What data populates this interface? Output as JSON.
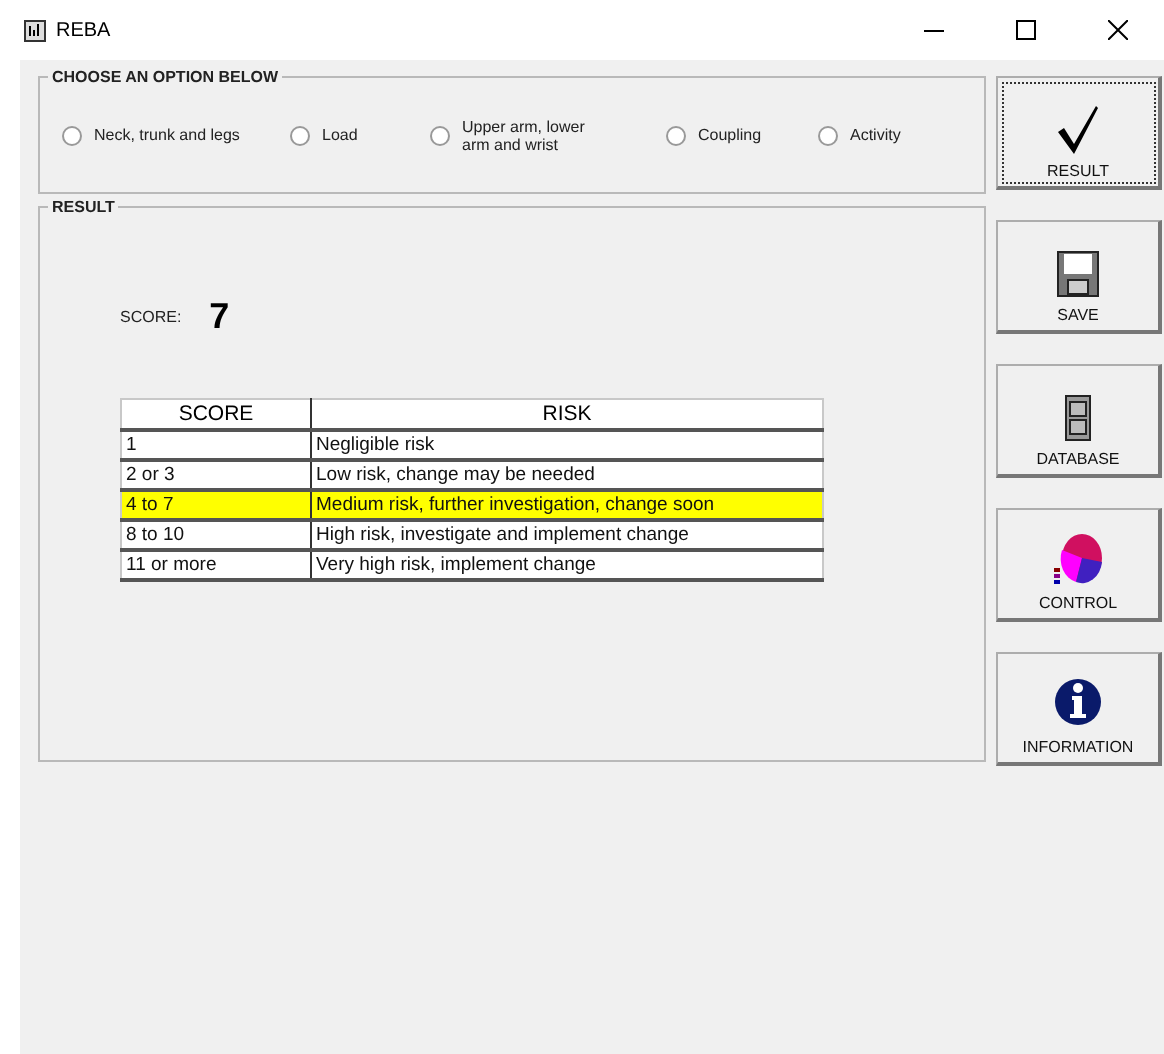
{
  "window": {
    "title": "REBA"
  },
  "options": {
    "title": "CHOOSE AN OPTION BELOW",
    "items": [
      {
        "label": "Neck, trunk and legs",
        "selected": false
      },
      {
        "label": "Load",
        "selected": false
      },
      {
        "label": "Upper arm, lower arm and wrist",
        "selected": false
      },
      {
        "label": "Coupling",
        "selected": false
      },
      {
        "label": "Activity",
        "selected": false
      }
    ]
  },
  "result": {
    "title": "RESULT",
    "score_label": "SCORE:",
    "score": "7",
    "table": {
      "columns": [
        "SCORE",
        "RISK"
      ],
      "rows": [
        {
          "cells": [
            "1",
            "Negligible risk"
          ],
          "highlighted": false
        },
        {
          "cells": [
            "2 or 3",
            "Low risk, change may be needed"
          ],
          "highlighted": false
        },
        {
          "cells": [
            "4 to 7",
            "Medium risk, further investigation, change soon"
          ],
          "highlighted": true
        },
        {
          "cells": [
            "8 to 10",
            "High risk, investigate and implement change"
          ],
          "highlighted": false
        },
        {
          "cells": [
            "11 or more",
            "Very high risk, implement change"
          ],
          "highlighted": false
        }
      ]
    }
  },
  "buttons": [
    {
      "label": "RESULT",
      "kind": "check",
      "focused": true
    },
    {
      "label": "SAVE",
      "kind": "floppy",
      "focused": false
    },
    {
      "label": "DATABASE",
      "kind": "cabinet",
      "focused": false
    },
    {
      "label": "CONTROL",
      "kind": "chart",
      "focused": false
    },
    {
      "label": "INFORMATION",
      "kind": "info",
      "focused": false
    }
  ]
}
